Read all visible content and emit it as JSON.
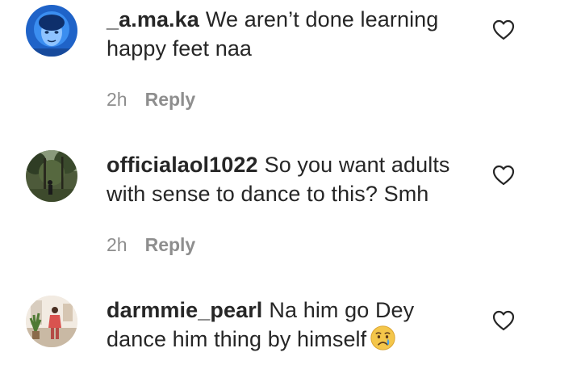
{
  "comments": [
    {
      "username": "_a.ma.ka",
      "text": "We aren’t done learning happy feet naa",
      "time": "2h",
      "reply_label": "Reply",
      "avatar_icon": "avatar-blue-filter-selfie"
    },
    {
      "username": "officialaol1022",
      "text": "So you want adults with sense to dance to this? Smh",
      "time": "2h",
      "reply_label": "Reply",
      "avatar_icon": "avatar-forest-photo"
    },
    {
      "username": "darmmie_pearl",
      "text": "Na him go Dey dance him thing by himself",
      "emoji": "crying-face-emoji",
      "time": "",
      "reply_label": "",
      "avatar_icon": "avatar-room-photo"
    }
  ],
  "icons": {
    "like": "heart-outline-icon"
  },
  "colors": {
    "text": "#262626",
    "meta": "#8e8e8e"
  }
}
